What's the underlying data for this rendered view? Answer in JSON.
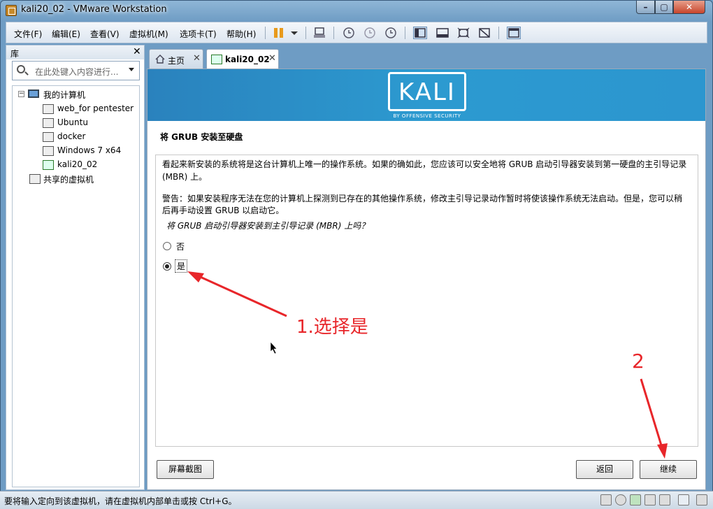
{
  "window": {
    "title": "kali20_02 - VMware Workstation",
    "min": "–",
    "max": "▢",
    "close": "✕"
  },
  "menu": [
    "文件(F)",
    "编辑(E)",
    "查看(V)",
    "虚拟机(M)",
    "选项卡(T)",
    "帮助(H)"
  ],
  "library": {
    "title": "库",
    "close": "✕",
    "search_placeholder": "在此处键入内容进行...",
    "tree": {
      "root": "我的计算机",
      "vms": [
        "web_for pentester",
        "Ubuntu",
        "docker",
        "Windows 7 x64",
        "kali20_02"
      ],
      "shared": "共享的虚拟机"
    }
  },
  "tabs": [
    {
      "label": "主页",
      "close": "✕"
    },
    {
      "label": "kali20_02",
      "close": "✕"
    }
  ],
  "installer": {
    "logo": "KALI",
    "logo_sub": "BY OFFENSIVE SECURITY",
    "step_title": "将 GRUB 安装至硬盘",
    "para1_line1": "看起来新安装的系统将是这台计算机上唯一的操作系统。如果的确如此，您应该可以安全地将 GRUB 启动引导器安装到第一硬盘的主引导记录",
    "para1_line2": "(MBR) 上。",
    "para2_line1": "警告：如果安装程序无法在您的计算机上探测到已存在的其他操作系统，修改主引导记录动作暂时将使该操作系统无法启动。但是，您可以稍",
    "para2_line2": "后再手动设置 GRUB 以启动它。",
    "question": "将 GRUB 启动引导器安装到主引导记录 (MBR) 上吗？",
    "options": [
      {
        "label": "否",
        "selected": false
      },
      {
        "label": "是",
        "selected": true
      }
    ],
    "screenshot_button": "屏幕截图",
    "back_button": "返回",
    "continue_button": "继续"
  },
  "annotations": {
    "step1": "1.选择是",
    "step2": "2",
    "color": "#e8262a"
  },
  "status": {
    "text": "要将输入定向到该虚拟机，请在虚拟机内部单击或按 Ctrl+G。"
  }
}
